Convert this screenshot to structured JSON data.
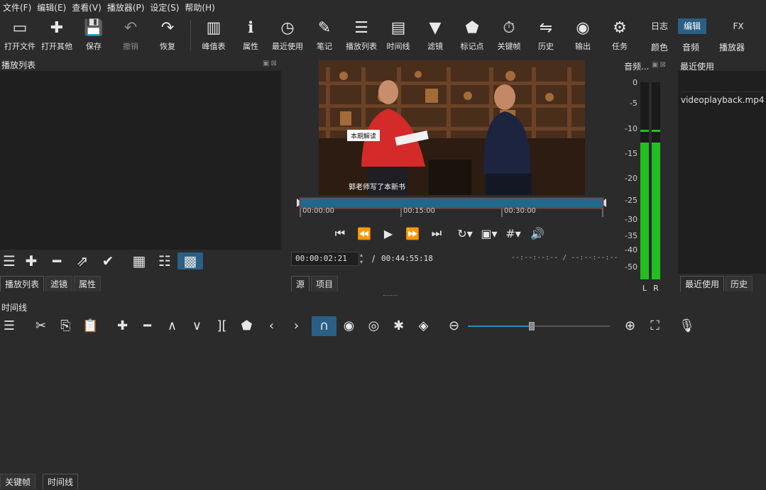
{
  "menu": [
    "文件(F)",
    "编辑(E)",
    "查看(V)",
    "播放器(P)",
    "设定(S)",
    "帮助(H)"
  ],
  "toolbar": [
    {
      "label": "打开文件",
      "icon": "open-file-icon",
      "glyph": "▭"
    },
    {
      "label": "打开其他",
      "icon": "open-other-icon",
      "glyph": "✚"
    },
    {
      "label": "保存",
      "icon": "save-icon",
      "glyph": "💾"
    },
    {
      "label": "撤销",
      "icon": "undo-icon",
      "glyph": "↶",
      "disabled": true
    },
    {
      "label": "恢复",
      "icon": "redo-icon",
      "glyph": "↷"
    },
    {
      "label": "峰值表",
      "icon": "peak-meter-icon",
      "glyph": "▥"
    },
    {
      "label": "属性",
      "icon": "properties-icon",
      "glyph": "ℹ"
    },
    {
      "label": "最近使用",
      "icon": "recent-icon",
      "glyph": "◷"
    },
    {
      "label": "笔记",
      "icon": "notes-icon",
      "glyph": "✎"
    },
    {
      "label": "播放列表",
      "icon": "playlist-icon",
      "glyph": "☰"
    },
    {
      "label": "时间线",
      "icon": "timeline-icon",
      "glyph": "▤"
    },
    {
      "label": "滤镜",
      "icon": "filter-icon",
      "glyph": "▼"
    },
    {
      "label": "标记点",
      "icon": "marker-icon",
      "glyph": "⬟"
    },
    {
      "label": "关键帧",
      "icon": "keyframe-icon",
      "glyph": "⏱"
    },
    {
      "label": "历史",
      "icon": "history-icon",
      "glyph": "⇋"
    },
    {
      "label": "输出",
      "icon": "export-icon",
      "glyph": "◉"
    },
    {
      "label": "任务",
      "icon": "jobs-icon",
      "glyph": "⚙"
    }
  ],
  "layouts": {
    "row1": [
      "日志",
      "编辑",
      "FX"
    ],
    "row2": [
      "颜色",
      "音频",
      "播放器"
    ],
    "active": "编辑"
  },
  "playlist": {
    "title": "播放列表",
    "tabs": [
      "播放列表",
      "滤镜",
      "属性"
    ]
  },
  "player": {
    "caption_badge": "本期解读",
    "subtitle": "郭老师写了本新书",
    "ticks": [
      "00:00:00",
      "00:15:00",
      "00:30:00"
    ],
    "current_time": "00:00:02:21",
    "separator": "/",
    "duration": "00:44:55:18",
    "in_out": "--:--:--:-- / --:--:--:--",
    "tabs": [
      "源",
      "项目"
    ]
  },
  "audio_meter": {
    "title": "音频...",
    "scale": [
      "0",
      "-5",
      "-10",
      "-15",
      "-20",
      "-25",
      "-30",
      "-35",
      "-40",
      "-50"
    ],
    "channels": [
      "L",
      "R"
    ],
    "level_db": -10
  },
  "recent": {
    "title": "最近使用",
    "items": [
      "videoplayback.mp4"
    ],
    "tabs": [
      "最近使用",
      "历史"
    ]
  },
  "timeline": {
    "title": "时间线",
    "zoom": 0.45
  },
  "bottom_tabs": [
    "关键帧",
    "时间线"
  ]
}
